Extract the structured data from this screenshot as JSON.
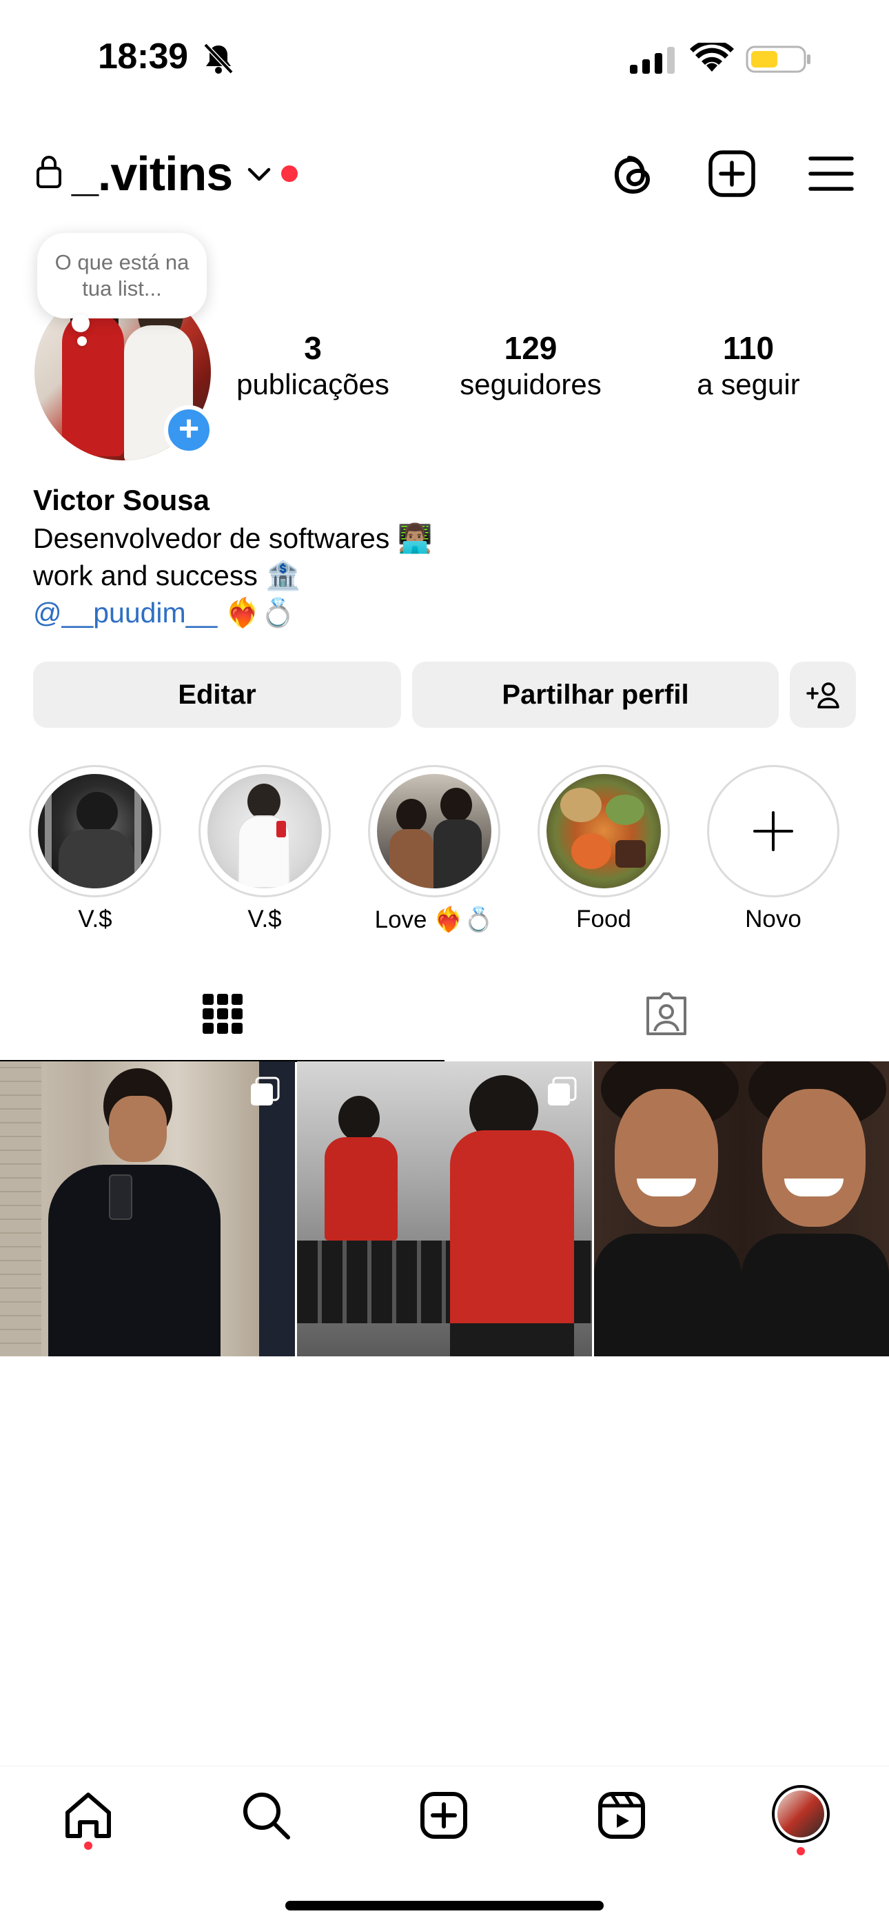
{
  "status_bar": {
    "time": "18:39",
    "battery_color": "#ffd426"
  },
  "header": {
    "username": "_.vitins"
  },
  "note": {
    "text": "O que está na tua list..."
  },
  "stats": [
    {
      "value": "3",
      "label": "publicações"
    },
    {
      "value": "129",
      "label": "seguidores"
    },
    {
      "value": "110",
      "label": "a seguir"
    }
  ],
  "profile": {
    "name": "Victor Sousa",
    "bio_line1": "Desenvolvedor de softwares 👨🏽‍💻",
    "bio_line2": "work and success 🏦",
    "bio_mention": "@__puudim__",
    "bio_mention_suffix": " ❤️‍🔥💍"
  },
  "buttons": {
    "edit": "Editar",
    "share": "Partilhar perfil"
  },
  "highlights": [
    {
      "label": "V.$"
    },
    {
      "label": "V.$"
    },
    {
      "label": "Love ❤️‍🔥💍"
    },
    {
      "label": "Food"
    },
    {
      "label": "Novo"
    }
  ],
  "colors": {
    "accent_blue": "#3897f0",
    "link_blue": "#2f6fc4",
    "notification_red": "#ff3040",
    "button_bg": "#efefef"
  }
}
